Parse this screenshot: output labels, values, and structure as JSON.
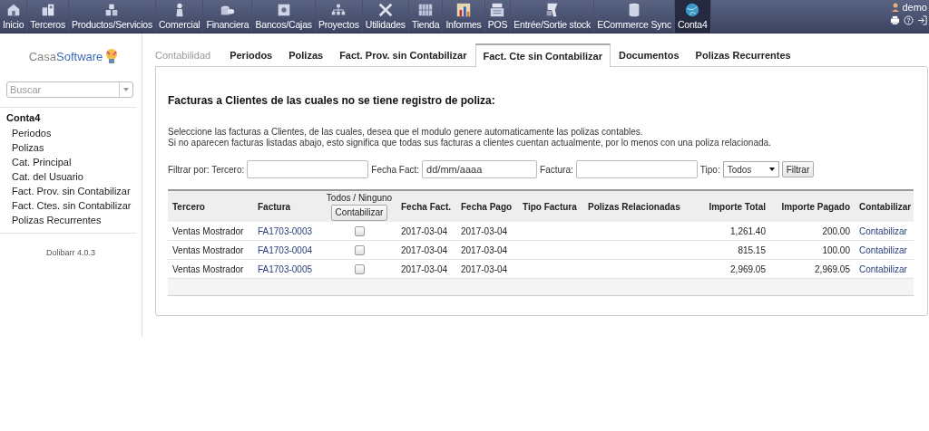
{
  "top_menu": [
    {
      "label": "Inicio",
      "selected": false
    },
    {
      "label": "Terceros",
      "selected": false
    },
    {
      "label": "Productos/Servicios",
      "selected": false
    },
    {
      "label": "Comercial",
      "selected": false
    },
    {
      "label": "Financiera",
      "selected": false
    },
    {
      "label": "Bancos/Cajas",
      "selected": false
    },
    {
      "label": "Proyectos",
      "selected": false
    },
    {
      "label": "Utilidades",
      "selected": false
    },
    {
      "label": "Tienda",
      "selected": false
    },
    {
      "label": "Informes",
      "selected": false
    },
    {
      "label": "POS",
      "selected": false
    },
    {
      "label": "Entrée/Sortie stock",
      "selected": false
    },
    {
      "label": "ECommerce Sync",
      "selected": false
    },
    {
      "label": "Conta4",
      "selected": true
    }
  ],
  "user": {
    "name": "demo"
  },
  "sidebar": {
    "logo": [
      "Casa",
      "Software"
    ],
    "search": {
      "placeholder": "Buscar"
    },
    "menu_title": "Conta4",
    "items": [
      {
        "label": "Periodos"
      },
      {
        "label": "Polizas"
      },
      {
        "label": "Cat. Principal"
      },
      {
        "label": "Cat. del Usuario"
      },
      {
        "label": "Fact. Prov. sin Contabilizar"
      },
      {
        "label": "Fact. Ctes. sin Contabilizar"
      },
      {
        "label": "Polizas Recurrentes"
      }
    ],
    "version": "Dolibarr 4.0.3"
  },
  "tabs_title": "Contabilidad",
  "tabs": [
    {
      "label": "Periodos",
      "selected": false
    },
    {
      "label": "Polizas",
      "selected": false
    },
    {
      "label": "Fact. Prov. sin Contabilizar",
      "selected": false
    },
    {
      "label": "Fact. Cte sin Contabilizar",
      "selected": true
    },
    {
      "label": "Documentos",
      "selected": false
    },
    {
      "label": "Polizas Recurrentes",
      "selected": false
    }
  ],
  "heading": "Facturas a Clientes de las cuales no se tiene registro de poliza:",
  "description": [
    "Seleccione las facturas a Clientes, de las cuales, desea que el modulo genere automaticamente las polizas contables.",
    "Si no aparecen facturas listadas abajo, esto significa que todas sus facturas a clientes cuentan actualmente, por lo menos con una poliza relacionada."
  ],
  "filters": {
    "label": "Filtrar por: Tercero:",
    "date_label": "Fecha Fact:",
    "date_value": "dd/mm/aaaa",
    "invoice_label": "Factura:",
    "type_label": "Tipo:",
    "type_value": "Todos",
    "button": "Filtrar"
  },
  "table": {
    "columns": [
      "Tercero",
      "Factura",
      {
        "label": "Todos / Ninguno",
        "button": "Contabilizar"
      },
      "Fecha Fact.",
      "Fecha Pago",
      "Tipo Factura",
      "Polizas Relacionadas",
      "Importe Total",
      "Importe Pagado",
      "Contabilizar"
    ],
    "rows": [
      {
        "tercero": "Ventas Mostrador",
        "factura": "FA1703-0003",
        "checked": false,
        "fecha_fact": "2017-03-04",
        "fecha_pago": "2017-03-04",
        "importe_total": "1,261.40",
        "importe_pagado": "200.00",
        "action": "Contabilizar"
      },
      {
        "tercero": "Ventas Mostrador",
        "factura": "FA1703-0004",
        "checked": false,
        "fecha_fact": "2017-03-04",
        "fecha_pago": "2017-03-04",
        "importe_total": "815.15",
        "importe_pagado": "100.00",
        "action": "Contabilizar"
      },
      {
        "tercero": "Ventas Mostrador",
        "factura": "FA1703-0005",
        "checked": false,
        "fecha_fact": "2017-03-04",
        "fecha_pago": "2017-03-04",
        "importe_total": "2,969.05",
        "importe_pagado": "2,969.05",
        "action": "Contabilizar"
      }
    ]
  }
}
